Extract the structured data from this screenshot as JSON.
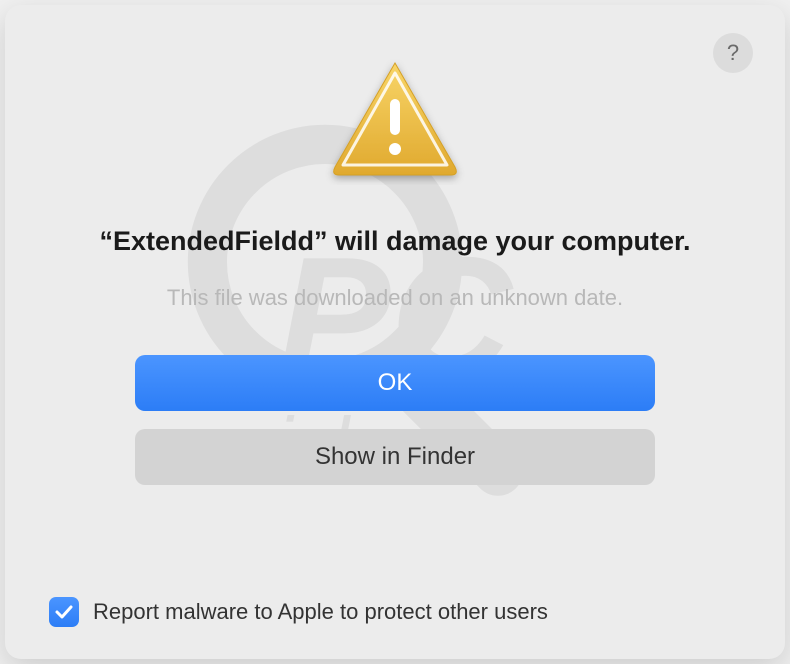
{
  "dialog": {
    "help_tooltip": "?",
    "app_name": "ExtendedFieldd",
    "title_prefix": "“",
    "title_suffix": "” will damage your computer.",
    "subtitle": "This file was downloaded on an unknown date.",
    "primary_button": "OK",
    "secondary_button": "Show in Finder",
    "checkbox_checked": true,
    "checkbox_label": "Report malware to Apple to protect other users"
  }
}
